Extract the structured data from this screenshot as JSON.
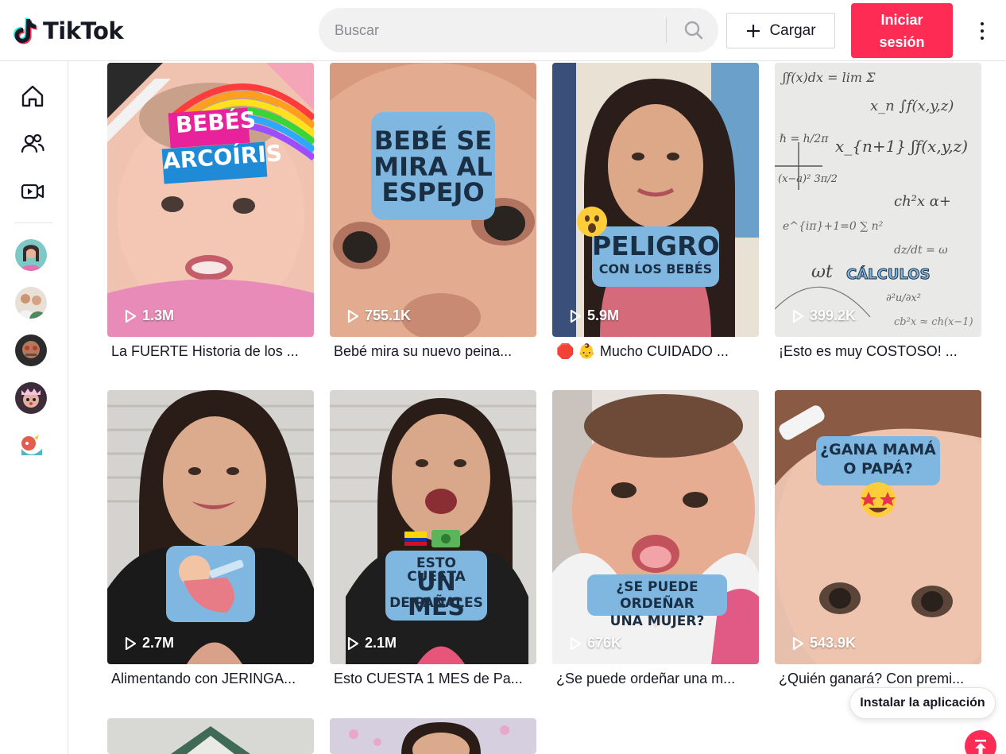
{
  "header": {
    "logo_text": "TikTok",
    "search_placeholder": "Buscar",
    "upload_label": "Cargar",
    "login_label": "Iniciar sesión"
  },
  "sidebar": {
    "nav": [
      {
        "name": "home-icon"
      },
      {
        "name": "following-icon"
      },
      {
        "name": "live-icon"
      }
    ],
    "avatars": 5
  },
  "videos": [
    {
      "views": "1.3M",
      "caption": "La FUERTE Historia de los ...",
      "overlay": [
        "BEBÉS",
        "ARCOÍRIS"
      ]
    },
    {
      "views": "755.1K",
      "caption": "Bebé mira su nuevo peina...",
      "overlay": [
        "BEBÉ SE",
        "MIRA AL",
        "ESPEJO"
      ]
    },
    {
      "views": "5.9M",
      "caption": "🛑 👶 Mucho CUIDADO ...",
      "overlay": [
        "PELIGRO",
        "CON LOS BEBÉS"
      ]
    },
    {
      "views": "399.2K",
      "caption": "¡Esto es muy COSTOSO! ...",
      "overlay": [
        "CÁLCULOS"
      ]
    },
    {
      "views": "2.7M",
      "caption": "Alimentando con JERINGA...",
      "overlay": []
    },
    {
      "views": "2.1M",
      "caption": "Esto CUESTA 1 MES de Pa...",
      "overlay": [
        "ESTO CUESTA",
        "UN MES",
        "DE PAÑALES"
      ]
    },
    {
      "views": "676K",
      "caption": "¿Se puede ordeñar una m...",
      "overlay": [
        "¿SE PUEDE ORDEÑAR",
        "UNA MUJER?"
      ]
    },
    {
      "views": "543.9K",
      "caption": "¿Quién ganará? Con premi...",
      "overlay": [
        "¿GANA MAMÁ",
        "O PAPÁ?"
      ]
    }
  ],
  "floating": {
    "install_label": "Instalar la aplicación"
  },
  "colors": {
    "brand": "#fe2c55",
    "text": "#161823",
    "border": "#e3e3e4"
  }
}
